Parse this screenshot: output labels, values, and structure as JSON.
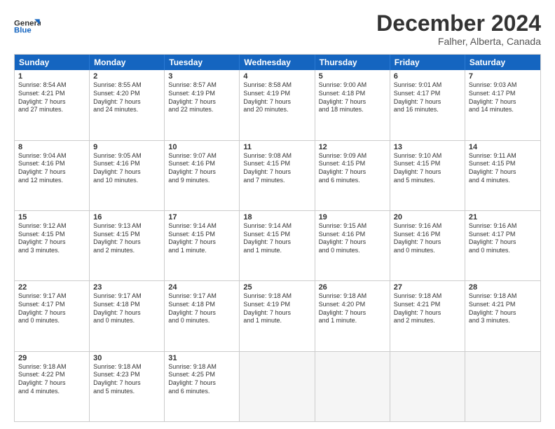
{
  "header": {
    "logo_line1": "General",
    "logo_line2": "Blue",
    "main_title": "December 2024",
    "sub_title": "Falher, Alberta, Canada"
  },
  "days_of_week": [
    "Sunday",
    "Monday",
    "Tuesday",
    "Wednesday",
    "Thursday",
    "Friday",
    "Saturday"
  ],
  "weeks": [
    [
      {
        "day": "1",
        "lines": [
          "Sunrise: 8:54 AM",
          "Sunset: 4:21 PM",
          "Daylight: 7 hours",
          "and 27 minutes."
        ]
      },
      {
        "day": "2",
        "lines": [
          "Sunrise: 8:55 AM",
          "Sunset: 4:20 PM",
          "Daylight: 7 hours",
          "and 24 minutes."
        ]
      },
      {
        "day": "3",
        "lines": [
          "Sunrise: 8:57 AM",
          "Sunset: 4:19 PM",
          "Daylight: 7 hours",
          "and 22 minutes."
        ]
      },
      {
        "day": "4",
        "lines": [
          "Sunrise: 8:58 AM",
          "Sunset: 4:19 PM",
          "Daylight: 7 hours",
          "and 20 minutes."
        ]
      },
      {
        "day": "5",
        "lines": [
          "Sunrise: 9:00 AM",
          "Sunset: 4:18 PM",
          "Daylight: 7 hours",
          "and 18 minutes."
        ]
      },
      {
        "day": "6",
        "lines": [
          "Sunrise: 9:01 AM",
          "Sunset: 4:17 PM",
          "Daylight: 7 hours",
          "and 16 minutes."
        ]
      },
      {
        "day": "7",
        "lines": [
          "Sunrise: 9:03 AM",
          "Sunset: 4:17 PM",
          "Daylight: 7 hours",
          "and 14 minutes."
        ]
      }
    ],
    [
      {
        "day": "8",
        "lines": [
          "Sunrise: 9:04 AM",
          "Sunset: 4:16 PM",
          "Daylight: 7 hours",
          "and 12 minutes."
        ]
      },
      {
        "day": "9",
        "lines": [
          "Sunrise: 9:05 AM",
          "Sunset: 4:16 PM",
          "Daylight: 7 hours",
          "and 10 minutes."
        ]
      },
      {
        "day": "10",
        "lines": [
          "Sunrise: 9:07 AM",
          "Sunset: 4:16 PM",
          "Daylight: 7 hours",
          "and 9 minutes."
        ]
      },
      {
        "day": "11",
        "lines": [
          "Sunrise: 9:08 AM",
          "Sunset: 4:15 PM",
          "Daylight: 7 hours",
          "and 7 minutes."
        ]
      },
      {
        "day": "12",
        "lines": [
          "Sunrise: 9:09 AM",
          "Sunset: 4:15 PM",
          "Daylight: 7 hours",
          "and 6 minutes."
        ]
      },
      {
        "day": "13",
        "lines": [
          "Sunrise: 9:10 AM",
          "Sunset: 4:15 PM",
          "Daylight: 7 hours",
          "and 5 minutes."
        ]
      },
      {
        "day": "14",
        "lines": [
          "Sunrise: 9:11 AM",
          "Sunset: 4:15 PM",
          "Daylight: 7 hours",
          "and 4 minutes."
        ]
      }
    ],
    [
      {
        "day": "15",
        "lines": [
          "Sunrise: 9:12 AM",
          "Sunset: 4:15 PM",
          "Daylight: 7 hours",
          "and 3 minutes."
        ]
      },
      {
        "day": "16",
        "lines": [
          "Sunrise: 9:13 AM",
          "Sunset: 4:15 PM",
          "Daylight: 7 hours",
          "and 2 minutes."
        ]
      },
      {
        "day": "17",
        "lines": [
          "Sunrise: 9:14 AM",
          "Sunset: 4:15 PM",
          "Daylight: 7 hours",
          "and 1 minute."
        ]
      },
      {
        "day": "18",
        "lines": [
          "Sunrise: 9:14 AM",
          "Sunset: 4:15 PM",
          "Daylight: 7 hours",
          "and 1 minute."
        ]
      },
      {
        "day": "19",
        "lines": [
          "Sunrise: 9:15 AM",
          "Sunset: 4:16 PM",
          "Daylight: 7 hours",
          "and 0 minutes."
        ]
      },
      {
        "day": "20",
        "lines": [
          "Sunrise: 9:16 AM",
          "Sunset: 4:16 PM",
          "Daylight: 7 hours",
          "and 0 minutes."
        ]
      },
      {
        "day": "21",
        "lines": [
          "Sunrise: 9:16 AM",
          "Sunset: 4:17 PM",
          "Daylight: 7 hours",
          "and 0 minutes."
        ]
      }
    ],
    [
      {
        "day": "22",
        "lines": [
          "Sunrise: 9:17 AM",
          "Sunset: 4:17 PM",
          "Daylight: 7 hours",
          "and 0 minutes."
        ]
      },
      {
        "day": "23",
        "lines": [
          "Sunrise: 9:17 AM",
          "Sunset: 4:18 PM",
          "Daylight: 7 hours",
          "and 0 minutes."
        ]
      },
      {
        "day": "24",
        "lines": [
          "Sunrise: 9:17 AM",
          "Sunset: 4:18 PM",
          "Daylight: 7 hours",
          "and 0 minutes."
        ]
      },
      {
        "day": "25",
        "lines": [
          "Sunrise: 9:18 AM",
          "Sunset: 4:19 PM",
          "Daylight: 7 hours",
          "and 1 minute."
        ]
      },
      {
        "day": "26",
        "lines": [
          "Sunrise: 9:18 AM",
          "Sunset: 4:20 PM",
          "Daylight: 7 hours",
          "and 1 minute."
        ]
      },
      {
        "day": "27",
        "lines": [
          "Sunrise: 9:18 AM",
          "Sunset: 4:21 PM",
          "Daylight: 7 hours",
          "and 2 minutes."
        ]
      },
      {
        "day": "28",
        "lines": [
          "Sunrise: 9:18 AM",
          "Sunset: 4:21 PM",
          "Daylight: 7 hours",
          "and 3 minutes."
        ]
      }
    ],
    [
      {
        "day": "29",
        "lines": [
          "Sunrise: 9:18 AM",
          "Sunset: 4:22 PM",
          "Daylight: 7 hours",
          "and 4 minutes."
        ]
      },
      {
        "day": "30",
        "lines": [
          "Sunrise: 9:18 AM",
          "Sunset: 4:23 PM",
          "Daylight: 7 hours",
          "and 5 minutes."
        ]
      },
      {
        "day": "31",
        "lines": [
          "Sunrise: 9:18 AM",
          "Sunset: 4:25 PM",
          "Daylight: 7 hours",
          "and 6 minutes."
        ]
      },
      {
        "day": "",
        "lines": []
      },
      {
        "day": "",
        "lines": []
      },
      {
        "day": "",
        "lines": []
      },
      {
        "day": "",
        "lines": []
      }
    ]
  ]
}
